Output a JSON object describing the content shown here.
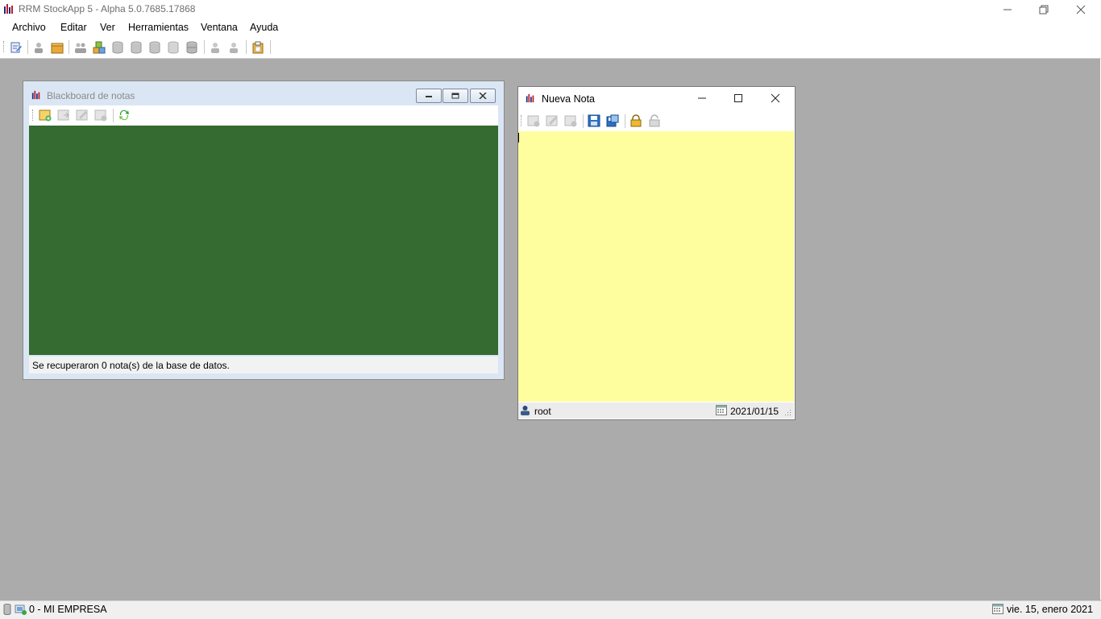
{
  "app": {
    "title": "RRM StockApp 5 - Alpha 5.0.7685.17868"
  },
  "menu": [
    "Archivo",
    "Editar",
    "Ver",
    "Herramientas",
    "Ventana",
    "Ayuda"
  ],
  "blackboard": {
    "title": "Blackboard de notas",
    "status": "Se recuperaron 0 nota(s) de la base de datos."
  },
  "note": {
    "title": "Nueva Nota",
    "user": "root",
    "date": "2021/01/15"
  },
  "statusbar": {
    "company": "0 - MI EMPRESA",
    "date": "vie. 15, enero 2021"
  },
  "colors": {
    "board": "#356a31",
    "note": "#fffe9e",
    "workspace": "#ababab"
  }
}
